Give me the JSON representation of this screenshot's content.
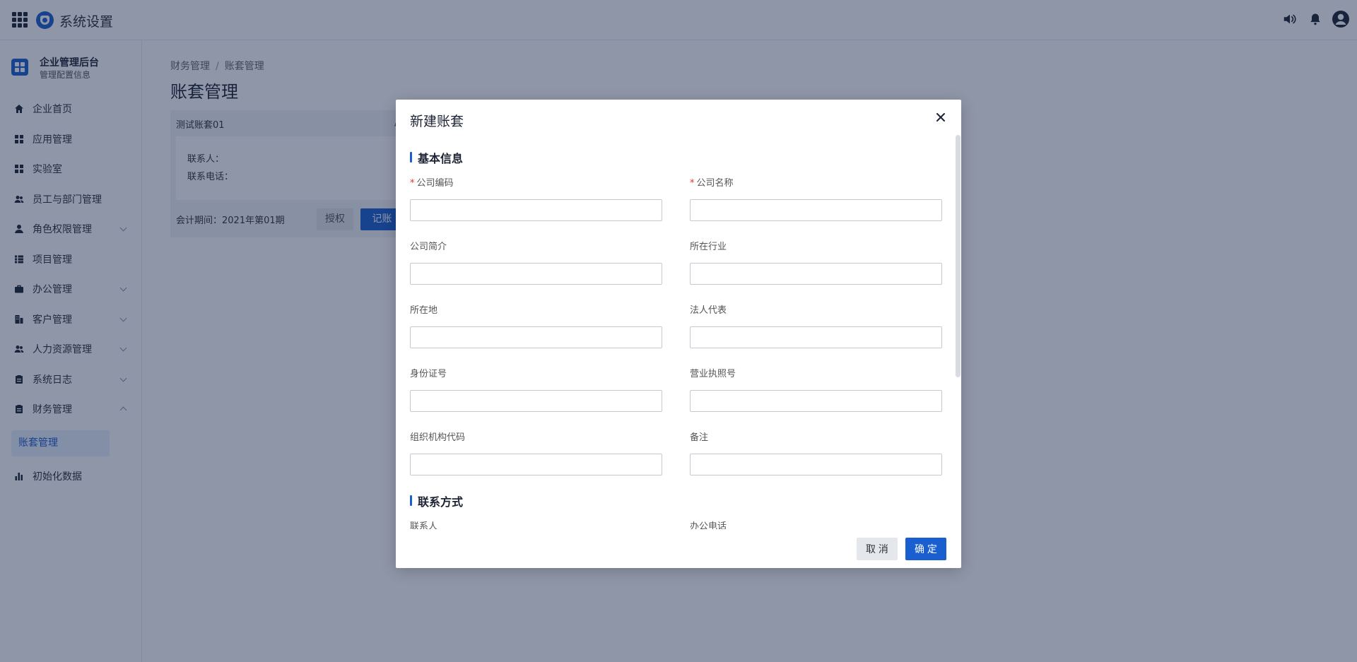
{
  "header": {
    "title": "系统设置"
  },
  "brand": {
    "title": "企业管理后台",
    "subtitle": "管理配置信息"
  },
  "sidebar": {
    "items": [
      {
        "label": "企业首页"
      },
      {
        "label": "应用管理"
      },
      {
        "label": "实验室"
      },
      {
        "label": "员工与部门管理"
      },
      {
        "label": "角色权限管理"
      },
      {
        "label": "项目管理"
      },
      {
        "label": "办公管理"
      },
      {
        "label": "客户管理"
      },
      {
        "label": "人力资源管理"
      },
      {
        "label": "系统日志"
      },
      {
        "label": "财务管理"
      },
      {
        "label": "初始化数据"
      }
    ],
    "active_sub": "账套管理"
  },
  "breadcrumb": [
    "财务管理",
    "/",
    "账套管理"
  ],
  "page_title": "账套管理",
  "account_card": {
    "name": "测试账套01",
    "contact_label": "联系人：",
    "phone_label": "联系电话：",
    "period_label": "会计期间：2021年第01期",
    "auth_button": "授权",
    "book_button": "记账"
  },
  "modal": {
    "title": "新建账套",
    "section_basic": "基本信息",
    "section_contact": "联系方式",
    "required_mark": "*",
    "fields": {
      "company_code": "公司编码",
      "company_name": "公司名称",
      "company_intro": "公司简介",
      "industry": "所在行业",
      "location": "所在地",
      "legal_rep": "法人代表",
      "id_number": "身份证号",
      "license_number": "营业执照号",
      "org_code": "组织机构代码",
      "remark": "备注",
      "contact_person": "联系人",
      "office_phone": "办公电话"
    },
    "cancel_button": "取 消",
    "ok_button": "确 定"
  },
  "colors": {
    "primary": "#1a5fd0",
    "required": "#e0352b",
    "overlay": "rgba(20,36,72,0.48)"
  }
}
